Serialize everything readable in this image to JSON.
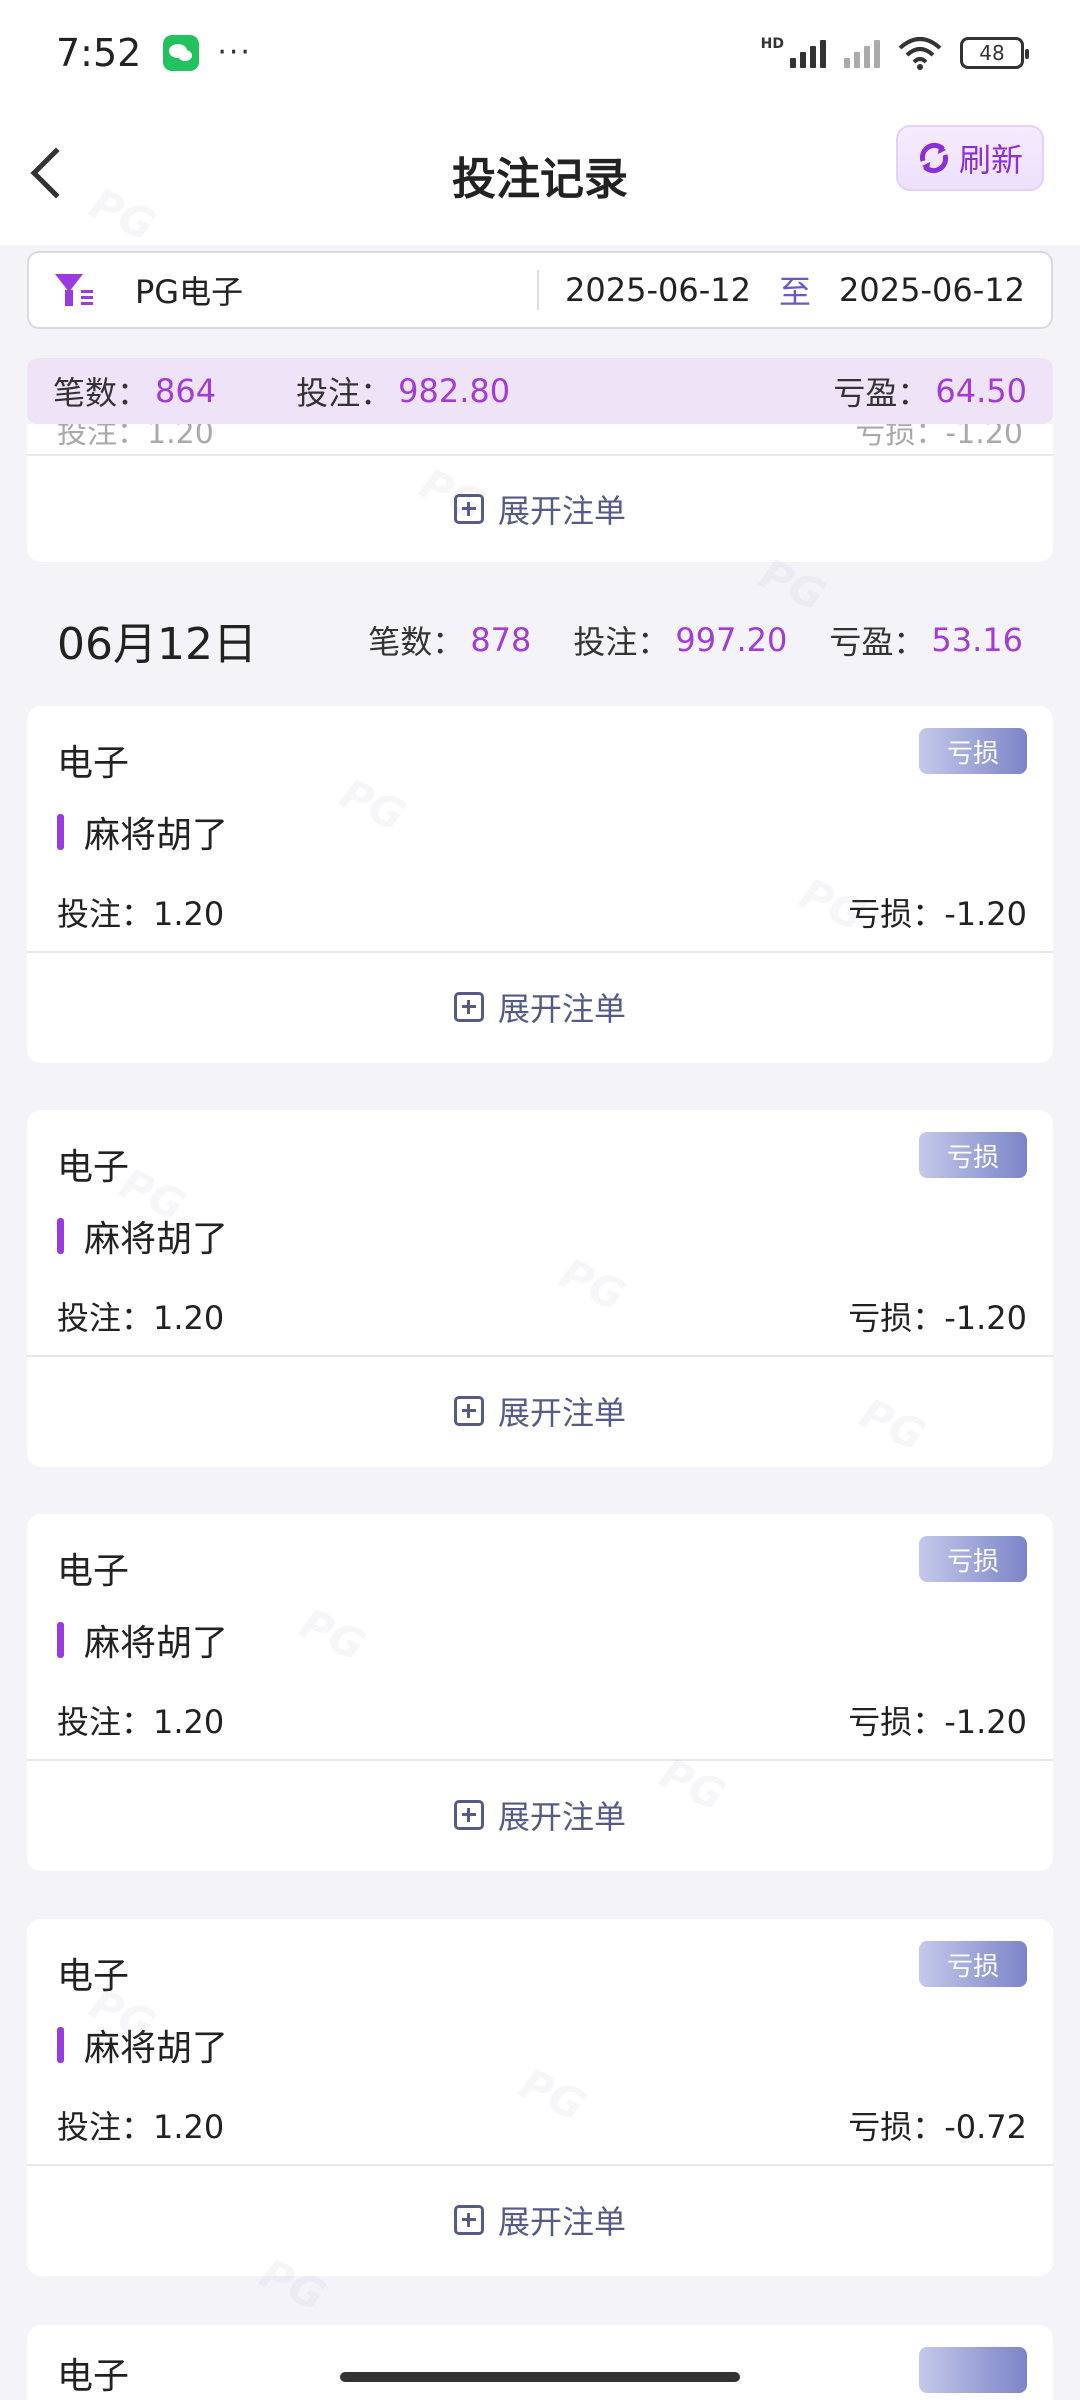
{
  "status_bar": {
    "time": "7:52",
    "dots": "···",
    "network_label": "HD",
    "battery": "48"
  },
  "header": {
    "title": "投注记录",
    "refresh_label": "刷新"
  },
  "filter": {
    "game": "PG电子",
    "date_from": "2025-06-12",
    "separator": "至",
    "date_to": "2025-06-12"
  },
  "summary": {
    "count_label": "笔数：",
    "count": "864",
    "bet_label": "投注：",
    "bet": "982.80",
    "profit_label": "亏盈：",
    "profit": "64.50"
  },
  "partial_card": {
    "bet_fragment": "投注：1.20",
    "loss_fragment": "亏损：-1.20",
    "expand_label": "展开注单"
  },
  "day": {
    "date": "06月12日",
    "count_label": "笔数：",
    "count": "878",
    "bet_label": "投注：",
    "bet": "997.20",
    "profit_label": "亏盈：",
    "profit": "53.16"
  },
  "cards": [
    {
      "type": "电子",
      "status": "亏损",
      "game": "麻将胡了",
      "bet": "投注：1.20",
      "loss": "亏损：-1.20",
      "expand": "展开注单"
    },
    {
      "type": "电子",
      "status": "亏损",
      "game": "麻将胡了",
      "bet": "投注：1.20",
      "loss": "亏损：-1.20",
      "expand": "展开注单"
    },
    {
      "type": "电子",
      "status": "亏损",
      "game": "麻将胡了",
      "bet": "投注：1.20",
      "loss": "亏损：-1.20",
      "expand": "展开注单"
    },
    {
      "type": "电子",
      "status": "亏损",
      "game": "麻将胡了",
      "bet": "投注：1.20",
      "loss": "亏损：-0.72",
      "expand": "展开注单"
    }
  ],
  "peek_card": {
    "type": "电子"
  },
  "watermark_text": "PG",
  "colors": {
    "accent": "#9b3ae0",
    "value_purple": "#a33bd6",
    "summary_bg": "#efe3f8",
    "badge": "#7b84c8"
  }
}
